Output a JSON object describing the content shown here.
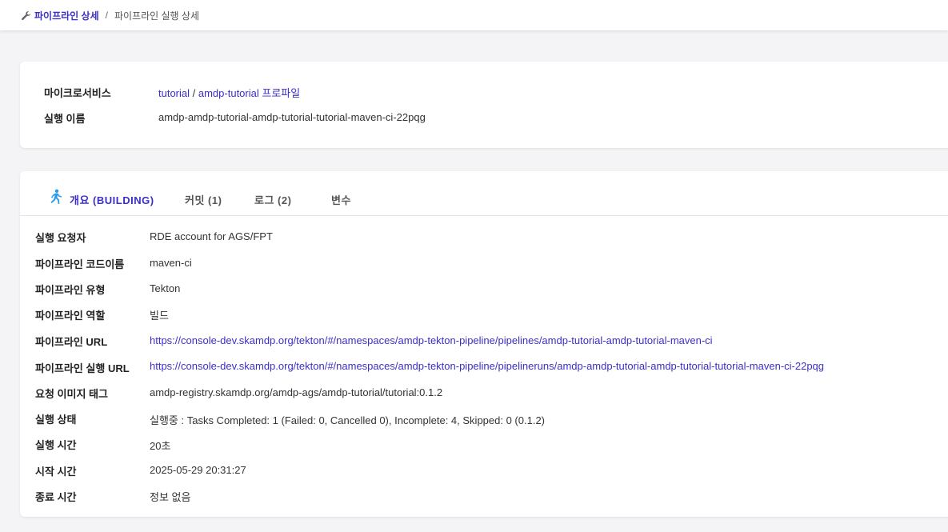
{
  "breadcrumb": {
    "parent": "파이프라인 상세",
    "separator": "/",
    "current": "파이프라인 실행 상세"
  },
  "summary": {
    "microservice_label": "마이크로서비스",
    "microservice_project": "tutorial",
    "microservice_sep": " / ",
    "microservice_profile": "amdp-tutorial 프로파일",
    "run_name_label": "실행 이름",
    "run_name": "amdp-amdp-tutorial-amdp-tutorial-tutorial-maven-ci-22pqg"
  },
  "tabs": [
    {
      "label": "개요 (BUILDING)",
      "icon": "running-person-icon"
    },
    {
      "label": "커밋 (1)"
    },
    {
      "label": "로그 (2)"
    },
    {
      "label": "변수"
    }
  ],
  "details": [
    {
      "label": "실행 요청자",
      "value": "RDE account for AGS/FPT"
    },
    {
      "label": "파이프라인 코드이름",
      "value": "maven-ci"
    },
    {
      "label": "파이프라인 유형",
      "value": "Tekton"
    },
    {
      "label": "파이프라인 역할",
      "value": "빌드"
    },
    {
      "label": "파이프라인 URL",
      "value": "https://console-dev.skamdp.org/tekton/#/namespaces/amdp-tekton-pipeline/pipelines/amdp-tutorial-amdp-tutorial-maven-ci"
    },
    {
      "label": "파이프라인 실행 URL",
      "value": "https://console-dev.skamdp.org/tekton/#/namespaces/amdp-tekton-pipeline/pipelineruns/amdp-amdp-tutorial-amdp-tutorial-tutorial-maven-ci-22pqg"
    },
    {
      "label": "요청 이미지 태그",
      "value": "amdp-registry.skamdp.org/amdp-ags/amdp-tutorial/tutorial:0.1.2"
    },
    {
      "label": "실행 상태",
      "value": "실행중 : Tasks Completed: 1 (Failed: 0, Cancelled 0), Incomplete: 4, Skipped: 0 (0.1.2)"
    },
    {
      "label": "실행 시간",
      "value": "20초"
    },
    {
      "label": "시작 시간",
      "value": "2025-05-29 20:31:27"
    },
    {
      "label": "종료 시간",
      "value": "정보 없음"
    }
  ],
  "colors": {
    "accent": "#3b2fc9",
    "runner_icon": "#2a9be8"
  }
}
